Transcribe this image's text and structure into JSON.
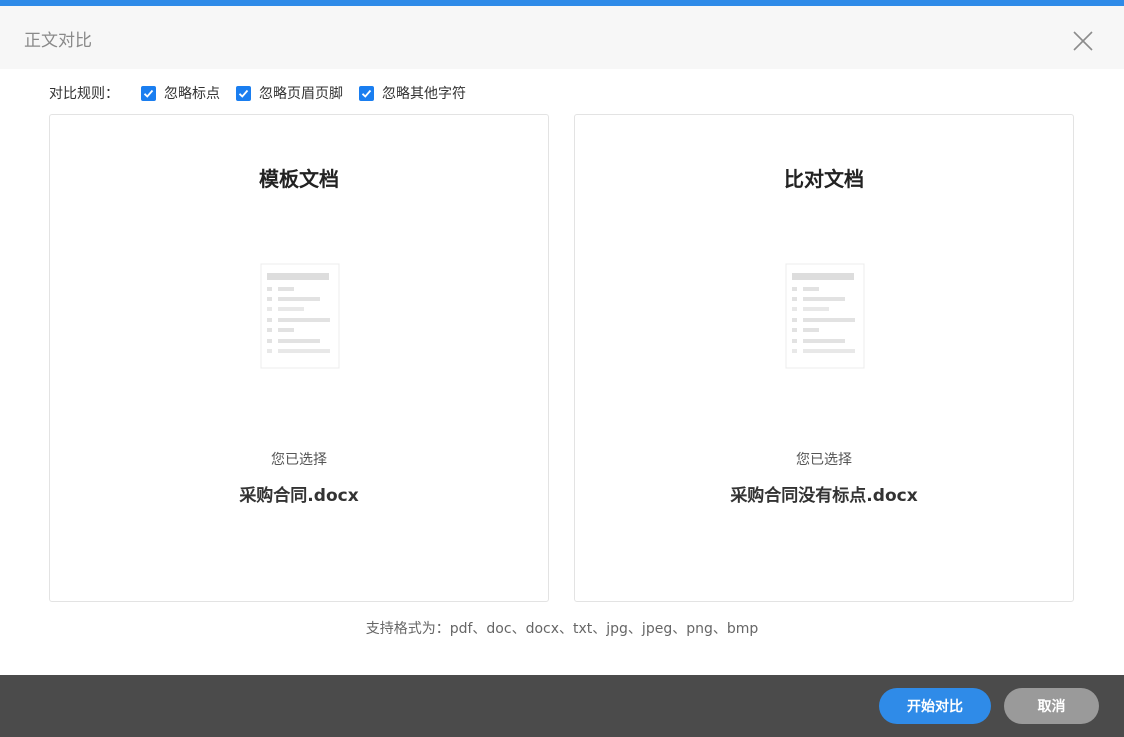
{
  "dialog": {
    "title": "正文对比"
  },
  "rules": {
    "label": "对比规则：",
    "options": [
      {
        "label": "忽略标点",
        "checked": true
      },
      {
        "label": "忽略页眉页脚",
        "checked": true
      },
      {
        "label": "忽略其他字符",
        "checked": true
      }
    ]
  },
  "panels": {
    "template": {
      "title": "模板文档",
      "selected_label": "您已选择",
      "file_name": "采购合同.docx"
    },
    "compare": {
      "title": "比对文档",
      "selected_label": "您已选择",
      "file_name": "采购合同没有标点.docx"
    }
  },
  "formats_text": "支持格式为：pdf、doc、docx、txt、jpg、jpeg、png、bmp",
  "footer": {
    "start_label": "开始对比",
    "cancel_label": "取消"
  },
  "colors": {
    "accent": "#2f8be8",
    "checkbox": "#1a7ef0",
    "footer_bg": "#4b4b4b",
    "cancel_bg": "#9a9a9a"
  },
  "icons": [
    "close-icon",
    "checkmark-icon",
    "document-icon"
  ]
}
